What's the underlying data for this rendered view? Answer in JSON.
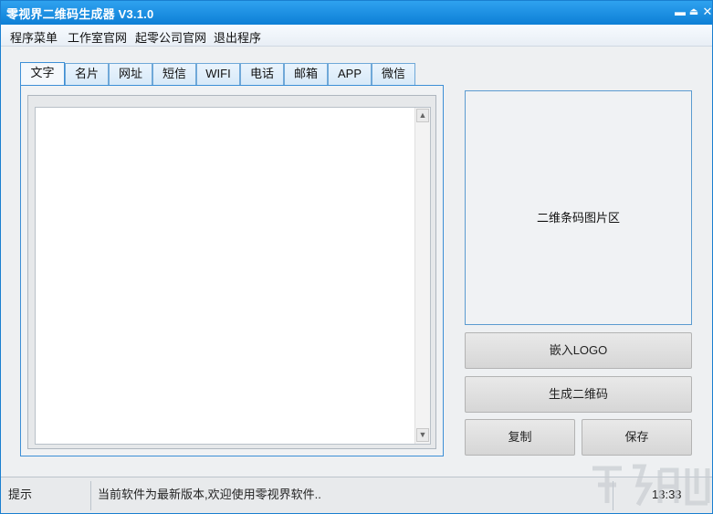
{
  "window": {
    "title": "零视界二维码生成器 V3.1.0"
  },
  "menu": {
    "items": [
      {
        "label": "程序菜单"
      },
      {
        "label": "工作室官网"
      },
      {
        "label": "起零公司官网"
      },
      {
        "label": "退出程序"
      }
    ]
  },
  "tabs": [
    {
      "label": "文字",
      "active": true
    },
    {
      "label": "名片"
    },
    {
      "label": "网址"
    },
    {
      "label": "短信"
    },
    {
      "label": "WIFI"
    },
    {
      "label": "电话"
    },
    {
      "label": "邮箱"
    },
    {
      "label": "APP"
    },
    {
      "label": "微信"
    }
  ],
  "editor": {
    "value": ""
  },
  "qr": {
    "placeholder": "二维条码图片区"
  },
  "buttons": {
    "embed_logo": "嵌入LOGO",
    "generate": "生成二维码",
    "copy": "复制",
    "save": "保存"
  },
  "status": {
    "label": "提示",
    "message": "当前软件为最新版本,欢迎使用零视界软件..",
    "time": "13:33"
  },
  "colors": {
    "titlebar": "#1a8ee3",
    "tab_border": "#3d8fd6",
    "panel_border": "#3d8fd6"
  }
}
